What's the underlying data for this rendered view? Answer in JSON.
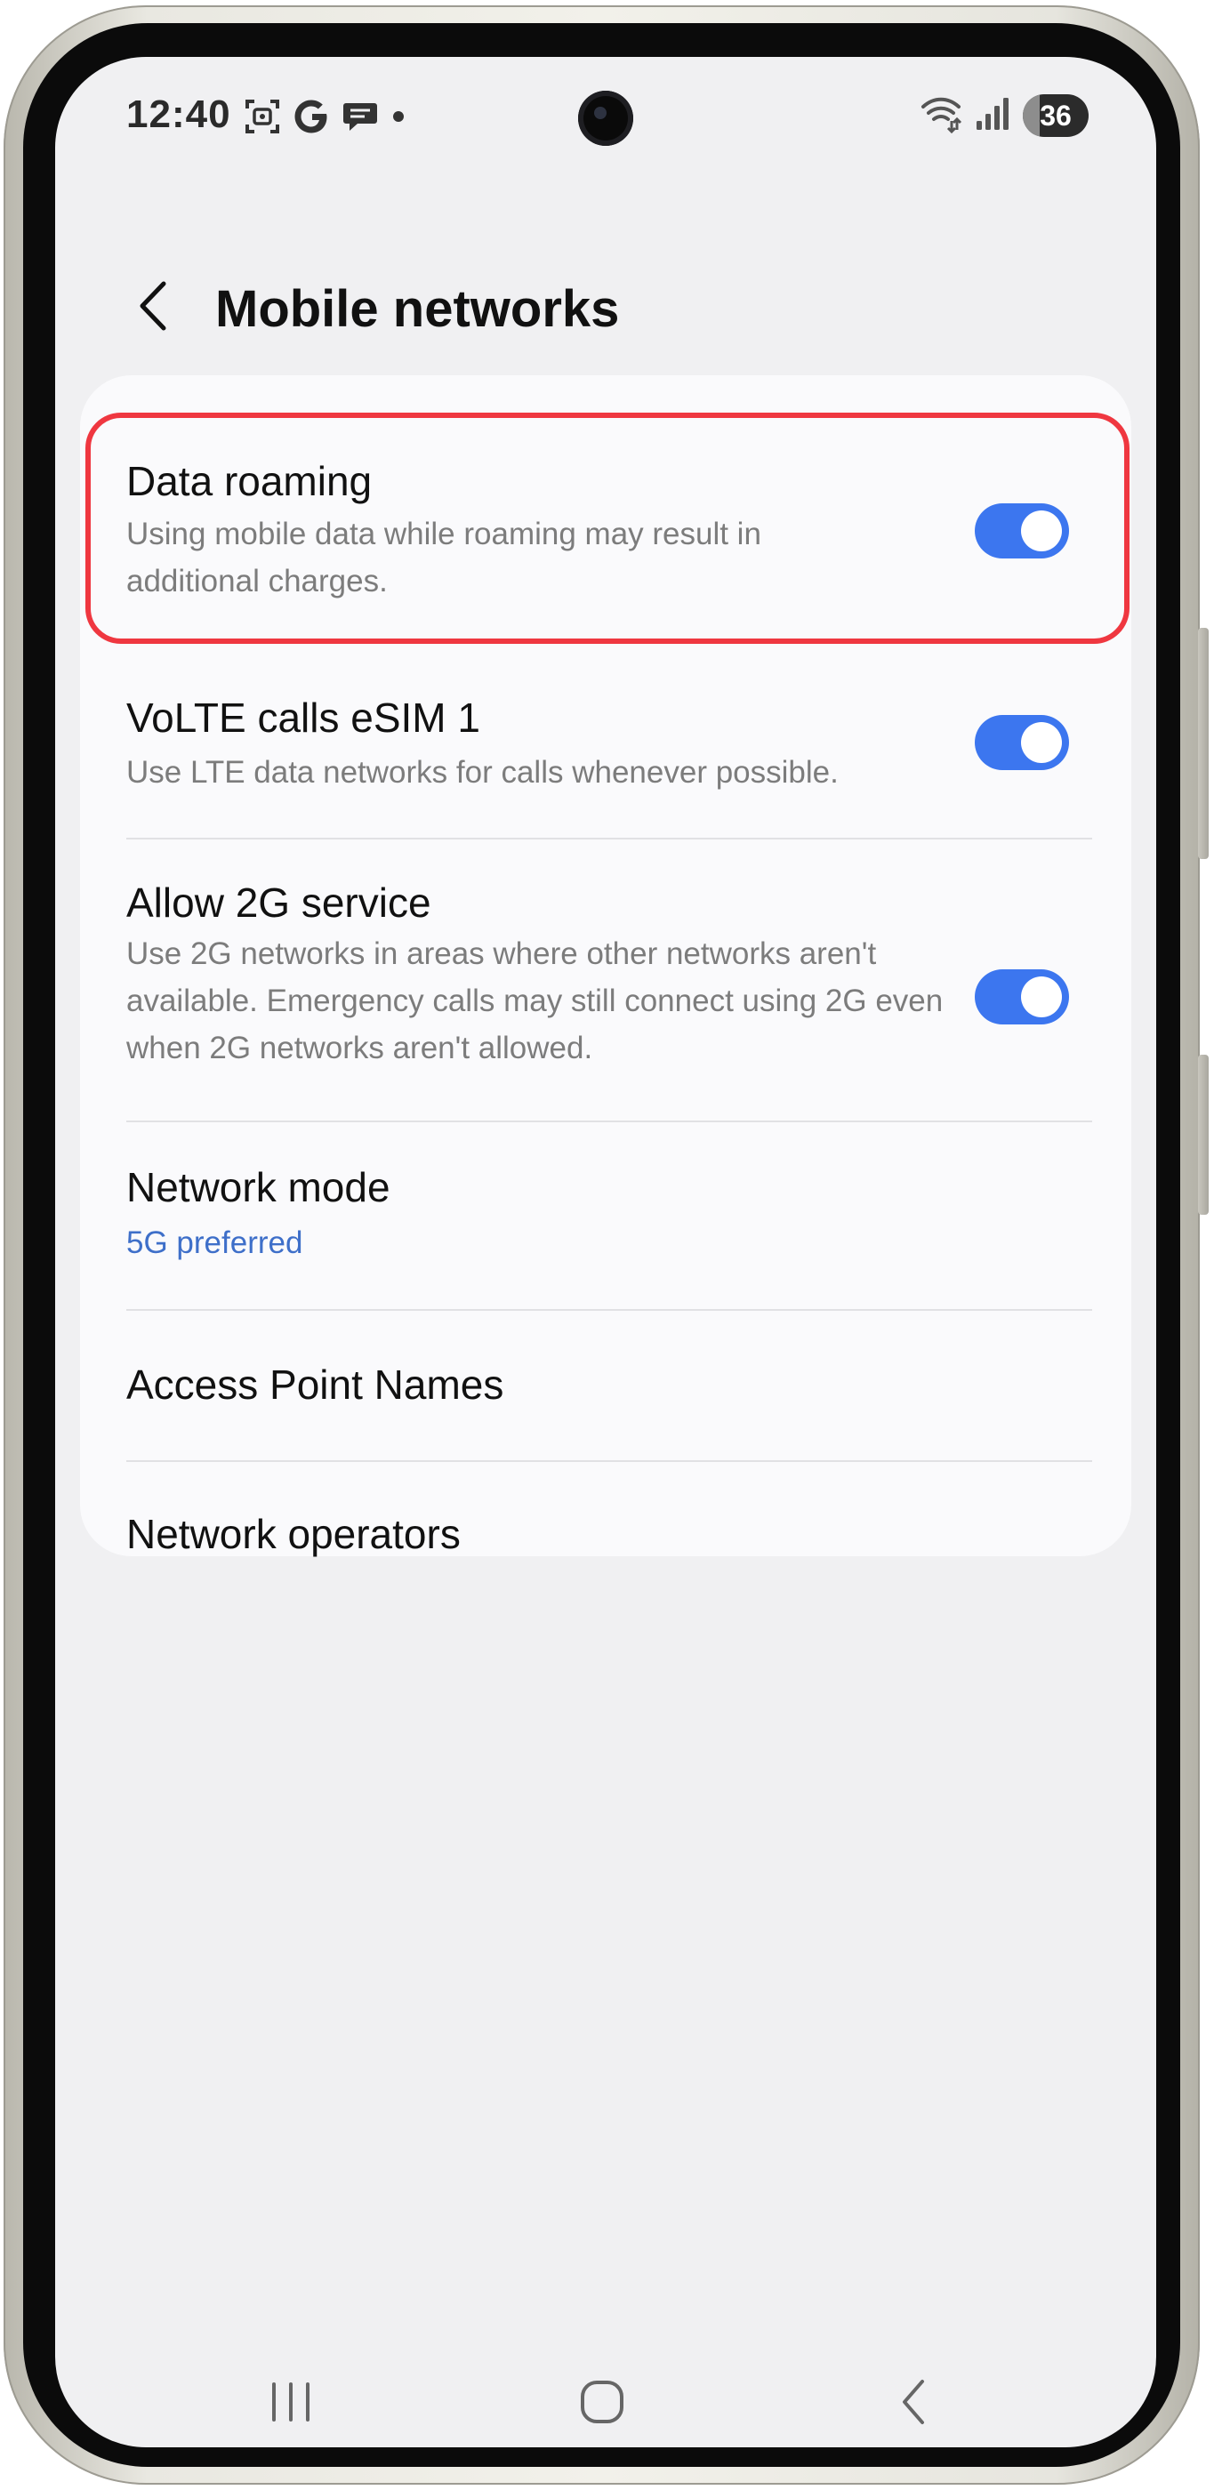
{
  "status_bar": {
    "time": "12:40",
    "battery_level": "36",
    "icons_left": [
      "screenshot-icon",
      "google-icon",
      "chat-icon",
      "dot-icon"
    ],
    "icons_right": [
      "wifi-calling-icon",
      "signal-icon",
      "battery-icon"
    ]
  },
  "header": {
    "back_icon": "chevron-left-icon",
    "title": "Mobile networks"
  },
  "settings": {
    "data_roaming": {
      "title": "Data roaming",
      "summary": "Using mobile data while roaming may result in additional charges.",
      "enabled": true
    },
    "volte": {
      "title": "VoLTE calls eSIM 1",
      "summary": "Use LTE data networks for calls whenever possible.",
      "enabled": true
    },
    "allow_2g": {
      "title": "Allow 2G service",
      "summary": "Use 2G networks in areas where other networks aren't available. Emergency calls may still connect using 2G even when 2G networks aren't allowed.",
      "enabled": true
    },
    "network_mode": {
      "title": "Network mode",
      "value": "5G preferred"
    },
    "apn": {
      "title": "Access Point Names"
    },
    "operators": {
      "title": "Network operators"
    }
  },
  "nav_bar": {
    "icons": [
      "recents-icon",
      "home-icon",
      "back-icon"
    ]
  },
  "colors": {
    "accent": "#3c76ef",
    "link": "#3e6fc9",
    "highlight": "#ef3740",
    "background": "#f0f0f2",
    "card": "#fafafc"
  }
}
